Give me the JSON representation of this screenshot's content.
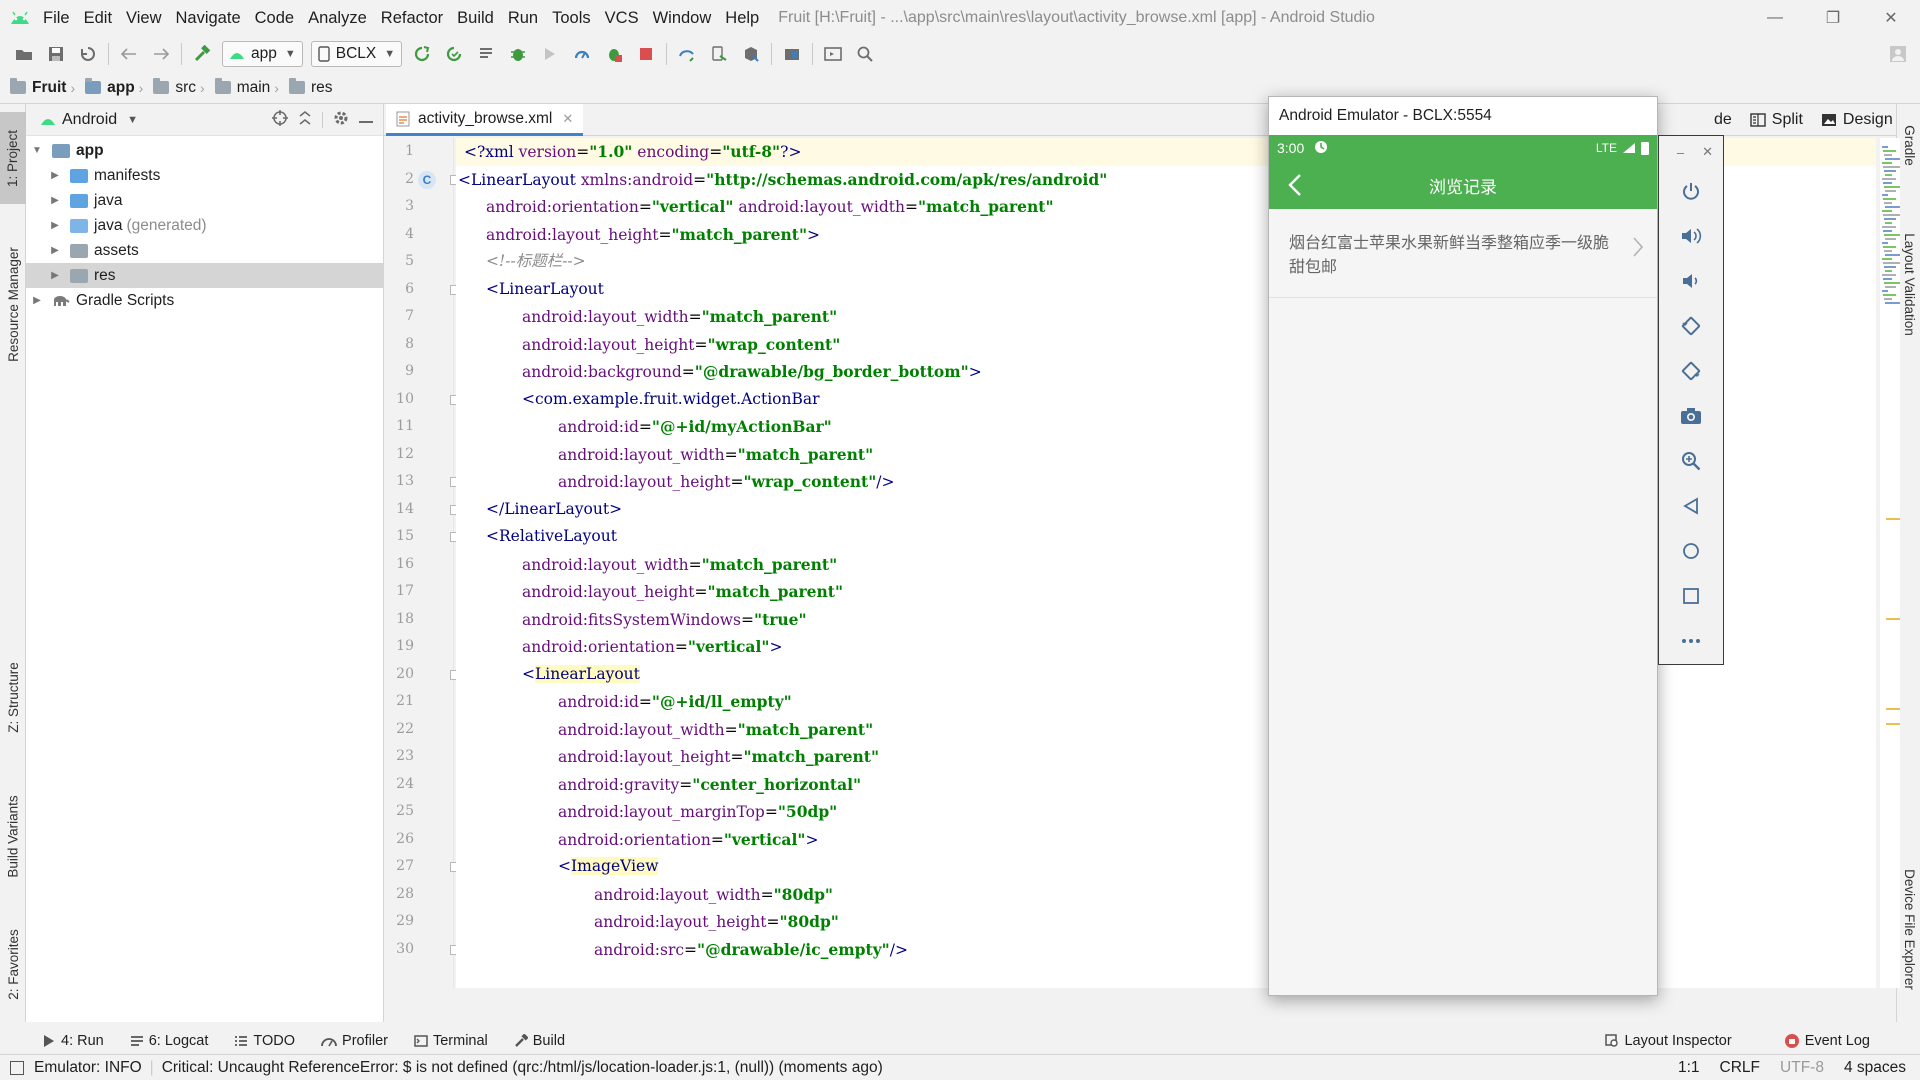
{
  "window": {
    "title": "Fruit [H:\\Fruit] - ...\\app\\src\\main\\res\\layout\\activity_browse.xml [app] - Android Studio",
    "controls": [
      "—",
      "❐",
      "✕"
    ]
  },
  "menu": [
    "File",
    "Edit",
    "View",
    "Navigate",
    "Code",
    "Analyze",
    "Refactor",
    "Build",
    "Run",
    "Tools",
    "VCS",
    "Window",
    "Help"
  ],
  "toolbar": {
    "run_config": "app",
    "device": "BCLX"
  },
  "breadcrumb": [
    "Fruit",
    "app",
    "src",
    "main",
    "res"
  ],
  "left_tabs": {
    "project": "1: Project",
    "resource_manager": "Resource Manager",
    "structure": "Z: Structure",
    "build_variants": "Build Variants",
    "favorites": "2: Favorites"
  },
  "right_tabs": {
    "gradle": "Gradle",
    "layout_validation": "Layout Validation",
    "device_file_explorer": "Device File Explorer"
  },
  "project_panel": {
    "view_mode": "Android",
    "tree": [
      {
        "label": "app",
        "depth": 0,
        "expanded": true,
        "kind": "module"
      },
      {
        "label": "manifests",
        "depth": 1,
        "expanded": false,
        "kind": "folder-blue"
      },
      {
        "label": "java",
        "depth": 1,
        "expanded": false,
        "kind": "folder-blue"
      },
      {
        "label": "java",
        "suffix": "(generated)",
        "depth": 1,
        "expanded": false,
        "kind": "folder-gen"
      },
      {
        "label": "assets",
        "depth": 1,
        "expanded": false,
        "kind": "folder-grey"
      },
      {
        "label": "res",
        "depth": 1,
        "expanded": false,
        "kind": "folder-res",
        "selected": true
      },
      {
        "label": "Gradle Scripts",
        "depth": 0,
        "expanded": false,
        "kind": "gradle"
      }
    ]
  },
  "editor": {
    "tab_label": "activity_browse.xml",
    "view_modes": [
      "de",
      "Split",
      "Design"
    ],
    "lines": [
      "1",
      "2",
      "3",
      "4",
      "5",
      "6",
      "7",
      "8",
      "9",
      "10",
      "11",
      "12",
      "13",
      "14",
      "15",
      "16",
      "17",
      "18",
      "19",
      "20",
      "21",
      "22",
      "23",
      "24",
      "25",
      "26",
      "27",
      "28",
      "29",
      "30"
    ]
  },
  "emulator": {
    "window_title": "Android Emulator - BCLX:5554",
    "status_time": "3:00",
    "status_network": "LTE",
    "app_title": "浏览记录",
    "list_item": "烟台红富士苹果水果新鲜当季整箱应季一级脆甜包邮",
    "accent_color": "#4caf50"
  },
  "bottom_tools": {
    "left": [
      {
        "label": "4: Run",
        "icon": "run-icon"
      },
      {
        "label": "6: Logcat",
        "icon": "logcat-icon"
      },
      {
        "label": "TODO",
        "icon": "todo-icon"
      },
      {
        "label": "Profiler",
        "icon": "profiler-icon"
      },
      {
        "label": "Terminal",
        "icon": "terminal-icon"
      },
      {
        "label": "Build",
        "icon": "build-icon"
      }
    ],
    "right": [
      {
        "label": "Layout Inspector",
        "icon": "layout-inspector-icon"
      },
      {
        "label": "Event Log",
        "icon": "event-log-icon"
      }
    ]
  },
  "status_bar": {
    "emulator": "Emulator: INFO",
    "message": "Critical: Uncaught ReferenceError: $ is not defined (qrc:/html/js/location-loader.js:1, (null)) (moments ago)",
    "position": "1:1",
    "line_sep": "CRLF",
    "encoding": "UTF-8",
    "indent": "4 spaces"
  }
}
